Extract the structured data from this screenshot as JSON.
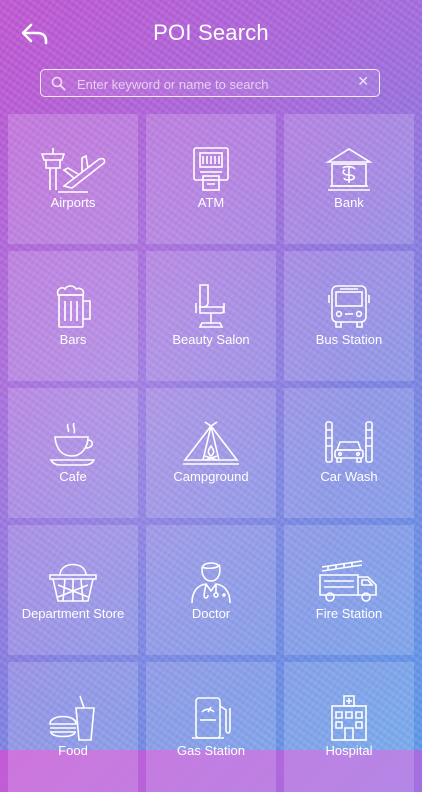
{
  "header": {
    "title": "POI Search"
  },
  "search": {
    "placeholder": "Enter keyword or name to search",
    "value": ""
  },
  "tiles": [
    {
      "label": "Airports",
      "icon": "airport-icon"
    },
    {
      "label": "ATM",
      "icon": "atm-icon"
    },
    {
      "label": "Bank",
      "icon": "bank-icon"
    },
    {
      "label": "Bars",
      "icon": "beer-mug-icon"
    },
    {
      "label": "Beauty Salon",
      "icon": "salon-chair-icon"
    },
    {
      "label": "Bus Station",
      "icon": "bus-icon"
    },
    {
      "label": "Cafe",
      "icon": "coffee-cup-icon"
    },
    {
      "label": "Campground",
      "icon": "tent-icon"
    },
    {
      "label": "Car Wash",
      "icon": "car-wash-icon"
    },
    {
      "label": "Department Store",
      "icon": "basket-icon"
    },
    {
      "label": "Doctor",
      "icon": "doctor-icon"
    },
    {
      "label": "Fire Station",
      "icon": "fire-truck-icon"
    },
    {
      "label": "Food",
      "icon": "food-icon"
    },
    {
      "label": "Gas Station",
      "icon": "gas-pump-icon"
    },
    {
      "label": "Hospital",
      "icon": "hospital-icon"
    }
  ]
}
